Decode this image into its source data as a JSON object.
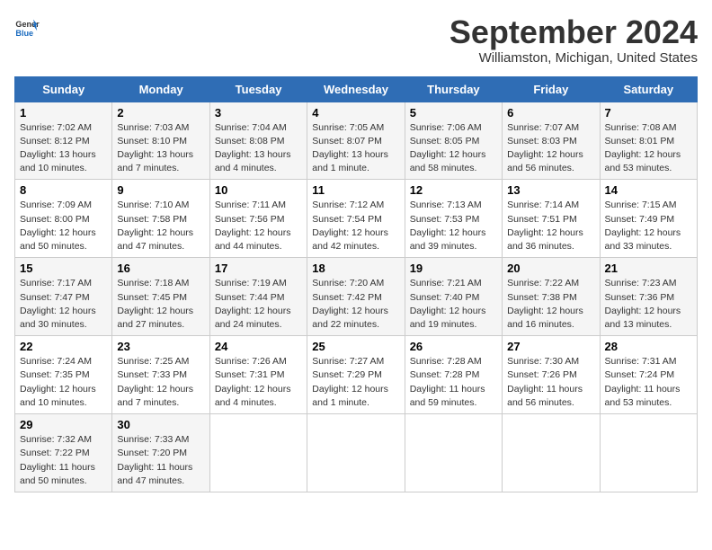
{
  "logo": {
    "line1": "General",
    "line2": "Blue"
  },
  "title": "September 2024",
  "subtitle": "Williamston, Michigan, United States",
  "headers": [
    "Sunday",
    "Monday",
    "Tuesday",
    "Wednesday",
    "Thursday",
    "Friday",
    "Saturday"
  ],
  "weeks": [
    [
      {
        "day": "1",
        "info": "Sunrise: 7:02 AM\nSunset: 8:12 PM\nDaylight: 13 hours and 10 minutes."
      },
      {
        "day": "2",
        "info": "Sunrise: 7:03 AM\nSunset: 8:10 PM\nDaylight: 13 hours and 7 minutes."
      },
      {
        "day": "3",
        "info": "Sunrise: 7:04 AM\nSunset: 8:08 PM\nDaylight: 13 hours and 4 minutes."
      },
      {
        "day": "4",
        "info": "Sunrise: 7:05 AM\nSunset: 8:07 PM\nDaylight: 13 hours and 1 minute."
      },
      {
        "day": "5",
        "info": "Sunrise: 7:06 AM\nSunset: 8:05 PM\nDaylight: 12 hours and 58 minutes."
      },
      {
        "day": "6",
        "info": "Sunrise: 7:07 AM\nSunset: 8:03 PM\nDaylight: 12 hours and 56 minutes."
      },
      {
        "day": "7",
        "info": "Sunrise: 7:08 AM\nSunset: 8:01 PM\nDaylight: 12 hours and 53 minutes."
      }
    ],
    [
      {
        "day": "8",
        "info": "Sunrise: 7:09 AM\nSunset: 8:00 PM\nDaylight: 12 hours and 50 minutes."
      },
      {
        "day": "9",
        "info": "Sunrise: 7:10 AM\nSunset: 7:58 PM\nDaylight: 12 hours and 47 minutes."
      },
      {
        "day": "10",
        "info": "Sunrise: 7:11 AM\nSunset: 7:56 PM\nDaylight: 12 hours and 44 minutes."
      },
      {
        "day": "11",
        "info": "Sunrise: 7:12 AM\nSunset: 7:54 PM\nDaylight: 12 hours and 42 minutes."
      },
      {
        "day": "12",
        "info": "Sunrise: 7:13 AM\nSunset: 7:53 PM\nDaylight: 12 hours and 39 minutes."
      },
      {
        "day": "13",
        "info": "Sunrise: 7:14 AM\nSunset: 7:51 PM\nDaylight: 12 hours and 36 minutes."
      },
      {
        "day": "14",
        "info": "Sunrise: 7:15 AM\nSunset: 7:49 PM\nDaylight: 12 hours and 33 minutes."
      }
    ],
    [
      {
        "day": "15",
        "info": "Sunrise: 7:17 AM\nSunset: 7:47 PM\nDaylight: 12 hours and 30 minutes."
      },
      {
        "day": "16",
        "info": "Sunrise: 7:18 AM\nSunset: 7:45 PM\nDaylight: 12 hours and 27 minutes."
      },
      {
        "day": "17",
        "info": "Sunrise: 7:19 AM\nSunset: 7:44 PM\nDaylight: 12 hours and 24 minutes."
      },
      {
        "day": "18",
        "info": "Sunrise: 7:20 AM\nSunset: 7:42 PM\nDaylight: 12 hours and 22 minutes."
      },
      {
        "day": "19",
        "info": "Sunrise: 7:21 AM\nSunset: 7:40 PM\nDaylight: 12 hours and 19 minutes."
      },
      {
        "day": "20",
        "info": "Sunrise: 7:22 AM\nSunset: 7:38 PM\nDaylight: 12 hours and 16 minutes."
      },
      {
        "day": "21",
        "info": "Sunrise: 7:23 AM\nSunset: 7:36 PM\nDaylight: 12 hours and 13 minutes."
      }
    ],
    [
      {
        "day": "22",
        "info": "Sunrise: 7:24 AM\nSunset: 7:35 PM\nDaylight: 12 hours and 10 minutes."
      },
      {
        "day": "23",
        "info": "Sunrise: 7:25 AM\nSunset: 7:33 PM\nDaylight: 12 hours and 7 minutes."
      },
      {
        "day": "24",
        "info": "Sunrise: 7:26 AM\nSunset: 7:31 PM\nDaylight: 12 hours and 4 minutes."
      },
      {
        "day": "25",
        "info": "Sunrise: 7:27 AM\nSunset: 7:29 PM\nDaylight: 12 hours and 1 minute."
      },
      {
        "day": "26",
        "info": "Sunrise: 7:28 AM\nSunset: 7:28 PM\nDaylight: 11 hours and 59 minutes."
      },
      {
        "day": "27",
        "info": "Sunrise: 7:30 AM\nSunset: 7:26 PM\nDaylight: 11 hours and 56 minutes."
      },
      {
        "day": "28",
        "info": "Sunrise: 7:31 AM\nSunset: 7:24 PM\nDaylight: 11 hours and 53 minutes."
      }
    ],
    [
      {
        "day": "29",
        "info": "Sunrise: 7:32 AM\nSunset: 7:22 PM\nDaylight: 11 hours and 50 minutes."
      },
      {
        "day": "30",
        "info": "Sunrise: 7:33 AM\nSunset: 7:20 PM\nDaylight: 11 hours and 47 minutes."
      },
      {
        "day": "",
        "info": ""
      },
      {
        "day": "",
        "info": ""
      },
      {
        "day": "",
        "info": ""
      },
      {
        "day": "",
        "info": ""
      },
      {
        "day": "",
        "info": ""
      }
    ]
  ]
}
